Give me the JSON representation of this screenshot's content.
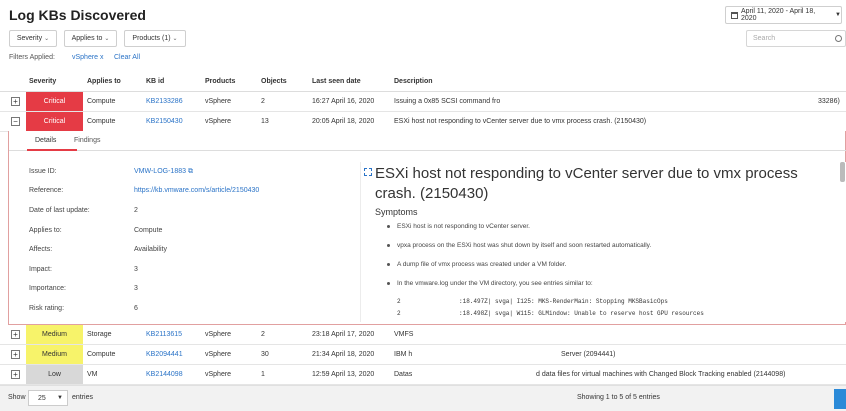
{
  "page": {
    "title": "Log KBs Discovered",
    "date_range": "April 11, 2020 - April 18, 2020"
  },
  "toolbar": {
    "filters": [
      {
        "label": "Severity"
      },
      {
        "label": "Applies to"
      },
      {
        "label": "Products (1)"
      }
    ],
    "search_placeholder": "Search",
    "filters_applied_label": "Filters Applied:",
    "chip_label": "vSphere x",
    "clear_all": "Clear All"
  },
  "table": {
    "columns": [
      "Severity",
      "Applies to",
      "KB id",
      "Products",
      "Objects",
      "Last seen date",
      "Description"
    ],
    "rows": [
      {
        "expander": "+",
        "severity": "Critical",
        "sev_class": "critical",
        "applies_to": "Compute",
        "kb": "KB2133286",
        "product": "vSphere",
        "objects": "2",
        "last_seen": "16:27 April 16, 2020",
        "description": "Issuing a 0x85 SCSI command fro",
        "desc_tail": "33286)"
      },
      {
        "expander": "−",
        "severity": "Critical",
        "sev_class": "critical",
        "applies_to": "Compute",
        "kb": "KB2150430",
        "product": "vSphere",
        "objects": "13",
        "last_seen": "20:05 April 18, 2020",
        "description": "ESXi host not responding to vCenter server due to vmx process crash. (2150430)",
        "desc_tail": ""
      },
      {
        "expander": "+",
        "severity": "Medium",
        "sev_class": "medium",
        "applies_to": "Storage",
        "kb": "KB2113615",
        "product": "vSphere",
        "objects": "2",
        "last_seen": "23:18 April 17, 2020",
        "description": "VMFS",
        "desc_tail": ""
      },
      {
        "expander": "+",
        "severity": "Medium",
        "sev_class": "medium",
        "applies_to": "Compute",
        "kb": "KB2094441",
        "product": "vSphere",
        "objects": "30",
        "last_seen": "21:34 April 18, 2020",
        "description": "IBM h",
        "desc_tail": "Server (2094441)"
      },
      {
        "expander": "+",
        "severity": "Low",
        "sev_class": "low",
        "applies_to": "VM",
        "kb": "KB2144098",
        "product": "vSphere",
        "objects": "1",
        "last_seen": "12:59 April 13, 2020",
        "description": "Datas",
        "desc_tail": "d data files for virtual machines with Changed Block Tracking enabled (2144098)"
      }
    ]
  },
  "details": {
    "tabs": [
      "Details",
      "Findings"
    ],
    "fields": [
      {
        "label": "Issue ID:",
        "value": "VMW-LOG-1883"
      },
      {
        "label": "Reference:",
        "value": "https://kb.vmware.com/s/article/2150430"
      },
      {
        "label": "Date of last update:",
        "value": "2"
      },
      {
        "label": "Applies to:",
        "value": "Compute"
      },
      {
        "label": "Affects:",
        "value": "Availability"
      },
      {
        "label": "Impact:",
        "value": "3"
      },
      {
        "label": "Importance:",
        "value": "3"
      },
      {
        "label": "Risk rating:",
        "value": "6"
      }
    ]
  },
  "kb_panel": {
    "title": "ESXi host not responding to vCenter server due to vmx process crash. (2150430)",
    "symptoms_heading": "Symptoms",
    "bullets": [
      "ESXi host is not responding to vCenter server.",
      "vpxa process on the ESXi host was shut down by itself and soon restarted automatically.",
      "A dump file of vmx process was created under a VM folder.",
      "In the vmware.log under the VM directory, you see entries similar to:"
    ],
    "log_lines": [
      {
        "prefix": "2",
        "text": ":18.497Z| svga| I125: MKS-RenderMain: Stopping MKSBasicOps"
      },
      {
        "prefix": "2",
        "text": ":18.498Z| svga| W115: GLMindow: Unable to reserve host GPU resources"
      }
    ]
  },
  "footer": {
    "show_label": "Show",
    "page_size": "25",
    "entries_label": "entries",
    "showing": "Showing 1 to 5 of 5 entries"
  },
  "colors": {
    "critical": "#e53b45",
    "medium": "#f7f36a",
    "low": "#d8d8d8",
    "link": "#2a73c7"
  }
}
